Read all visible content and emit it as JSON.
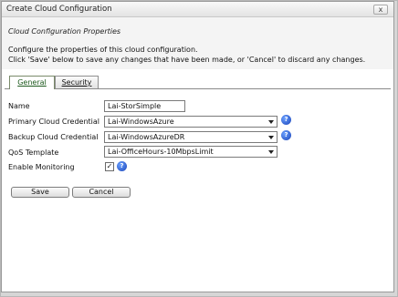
{
  "window": {
    "title": "Create Cloud Configuration",
    "close_label": "x"
  },
  "header": {
    "subtitle": "Cloud Configuration Properties",
    "description_line1": "Configure the properties of this cloud configuration.",
    "description_line2": "Click 'Save' below to save any changes that have been made, or 'Cancel' to discard any changes."
  },
  "tabs": [
    {
      "label": "General",
      "active": true
    },
    {
      "label": "Security",
      "active": false
    }
  ],
  "form": {
    "name": {
      "label": "Name",
      "value": "Lai-StorSimple"
    },
    "primary_credential": {
      "label": "Primary Cloud Credential",
      "value": "Lai-WindowsAzure"
    },
    "backup_credential": {
      "label": "Backup Cloud Credential",
      "value": "Lai-WindowsAzureDR"
    },
    "qos_template": {
      "label": "QoS Template",
      "value": "Lai-OfficeHours-10MbpsLimit"
    },
    "enable_monitoring": {
      "label": "Enable Monitoring",
      "checked": true,
      "check_glyph": "✓"
    },
    "help_glyph": "?"
  },
  "buttons": {
    "save": "Save",
    "cancel": "Cancel"
  }
}
